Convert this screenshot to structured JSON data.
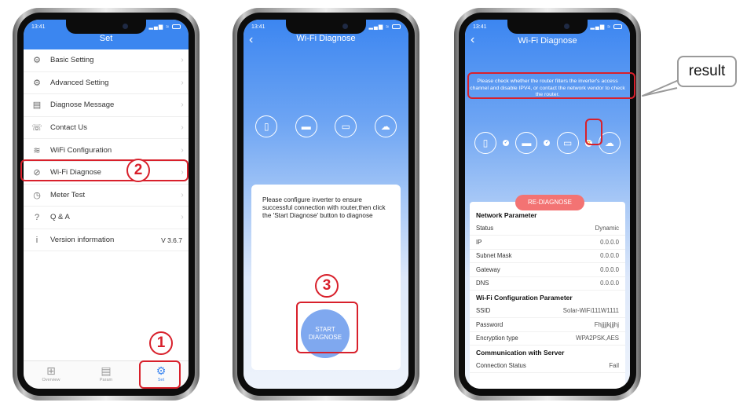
{
  "status_time": "13:41",
  "phone1": {
    "title": "Set",
    "menu": [
      {
        "label": "Basic Setting",
        "icon": "gear-icon",
        "glyph": "⚙"
      },
      {
        "label": "Advanced Setting",
        "icon": "advanced-gear-icon",
        "glyph": "⚙"
      },
      {
        "label": "Diagnose Message",
        "icon": "document-icon",
        "glyph": "▤"
      },
      {
        "label": "Contact Us",
        "icon": "phone-icon",
        "glyph": "☏"
      },
      {
        "label": "WiFi Configuration",
        "icon": "wifi-icon",
        "glyph": "≋"
      },
      {
        "label": "Wi-Fi Diagnose",
        "icon": "diagnose-icon",
        "glyph": "⊘"
      },
      {
        "label": "Meter Test",
        "icon": "meter-icon",
        "glyph": "◷"
      },
      {
        "label": "Q & A",
        "icon": "question-icon",
        "glyph": "?"
      },
      {
        "label": "Version information",
        "icon": "info-icon",
        "glyph": "i"
      }
    ],
    "version": "V 3.6.7",
    "tabs": [
      {
        "label": "Overview",
        "icon": "grid-icon",
        "glyph": "⊞"
      },
      {
        "label": "Param",
        "icon": "param-document-icon",
        "glyph": "▤"
      },
      {
        "label": "Set",
        "icon": "settings-icon",
        "glyph": "⚙"
      }
    ]
  },
  "phone2": {
    "title": "Wi-Fi Diagnose",
    "instruction": "Please configure inverter to ensure successful connection with router,then click the 'Start Diagnose' button to diagnose",
    "start_label": "START DIAGNOSE"
  },
  "phone3": {
    "title": "Wi-Fi Diagnose",
    "result_message": "Please check whether the router filters the inverter's access channel and disable IPV4, or contact the network vendor to check the router.",
    "rediagnose_label": "RE-DIAGNOSE",
    "sections": [
      {
        "title": "Network Parameter",
        "rows": [
          {
            "label": "Status",
            "value": "Dynamic"
          },
          {
            "label": "IP",
            "value": "0.0.0.0"
          },
          {
            "label": "Subnet Mask",
            "value": "0.0.0.0"
          },
          {
            "label": "Gateway",
            "value": "0.0.0.0"
          },
          {
            "label": "DNS",
            "value": "0.0.0.0"
          }
        ]
      },
      {
        "title": "Wi-Fi Configuration Parameter",
        "rows": [
          {
            "label": "SSID",
            "value": "Solar-WiFi111W1111"
          },
          {
            "label": "Password",
            "value": "Fhjjjjkjjjhj"
          },
          {
            "label": "Encryption type",
            "value": "WPA2PSK,AES"
          }
        ]
      },
      {
        "title": "Communication with Server",
        "rows": [
          {
            "label": "Connection Status",
            "value": "Fail"
          }
        ]
      }
    ]
  },
  "annotations": {
    "step1": "1",
    "step2": "2",
    "step3": "3",
    "callout": "result"
  },
  "colors": {
    "accent": "#3b86f0",
    "highlight": "#d8202b",
    "rediagnose": "#f37373"
  }
}
